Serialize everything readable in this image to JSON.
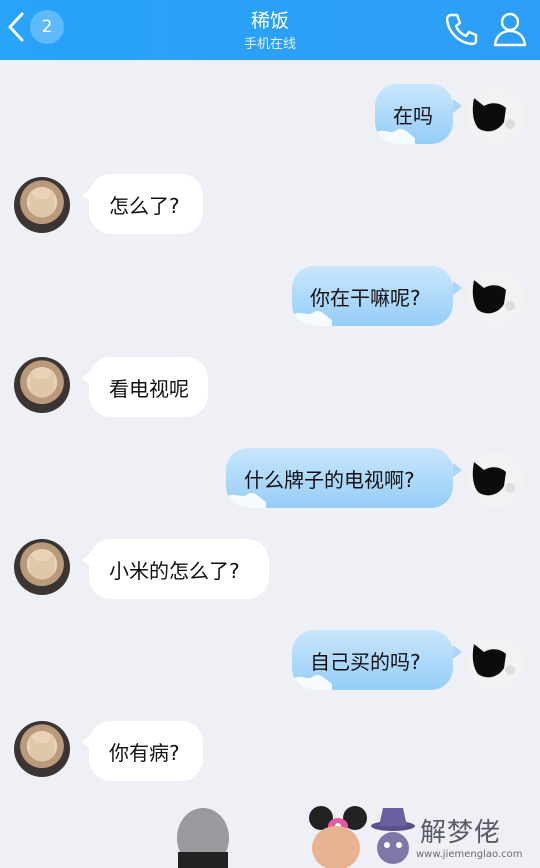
{
  "header": {
    "back_badge": "2",
    "title": "稀饭",
    "subtitle": "手机在线"
  },
  "messages": [
    {
      "side": "out",
      "text": "在吗"
    },
    {
      "side": "in",
      "text": "怎么了?"
    },
    {
      "side": "out",
      "text": "你在干嘛呢?"
    },
    {
      "side": "in",
      "text": "看电视呢"
    },
    {
      "side": "out",
      "text": "什么牌子的电视啊?"
    },
    {
      "side": "in",
      "text": "小米的怎么了?"
    },
    {
      "side": "out",
      "text": "自己买的吗?"
    },
    {
      "side": "in",
      "text": "你有病?"
    }
  ],
  "watermark": {
    "brand": "解梦佬",
    "url": "www.jiemenglao.com"
  },
  "colors": {
    "header": "#2aa0f7",
    "background": "#eef0f6",
    "bubble_out": "#a9d6f9",
    "bubble_in": "#ffffff"
  }
}
